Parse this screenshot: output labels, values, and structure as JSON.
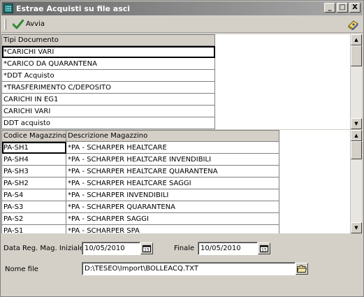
{
  "window": {
    "title": "Estrae Acquisti su file asci"
  },
  "titlebar_buttons": {
    "minimize": "_",
    "maximize": "□",
    "close": "X"
  },
  "toolbar": {
    "run_label": "Avvia"
  },
  "documents_grid": {
    "header": "Tipi Documento",
    "rows": [
      "*CARICHI VARI",
      "*CARICO DA QUARANTENA",
      "*DDT Acquisto",
      "*TRASFERIMENTO C/DEPOSITO",
      "CARICHI IN EG1",
      "CARICHI VARI",
      "DDT acquisto"
    ]
  },
  "warehouse_grid": {
    "headers": [
      "Codice Magazzino",
      "Descrizione Magazzino"
    ],
    "rows": [
      [
        "PA-SH1",
        "*PA - SCHARPER HEALTCARE"
      ],
      [
        "PA-SH4",
        "*PA - SCHARPER HEALTCARE INVENDIBILI"
      ],
      [
        "PA-SH3",
        "*PA - SCHARPER HEALTCARE QUARANTENA"
      ],
      [
        "PA-SH2",
        "*PA - SCHARPER HEALTCARE SAGGI"
      ],
      [
        "PA-S4",
        "*PA - SCHARPER INVENDIBILI"
      ],
      [
        "PA-S3",
        "*PA - SCHARPER QUARANTENA"
      ],
      [
        "PA-S2",
        "*PA - SCHARPER SAGGI"
      ],
      [
        "PA-S1",
        "*PA - SCHARPER SPA"
      ]
    ]
  },
  "form": {
    "date_start_label": "Data Reg. Mag. Iniziale",
    "date_start_value": "10/05/2010",
    "date_end_label": "Finale",
    "date_end_value": "10/05/2010",
    "file_label": "Nome file",
    "file_value": "D:\\TESEO\\Import\\BOLLEACQ.TXT"
  }
}
